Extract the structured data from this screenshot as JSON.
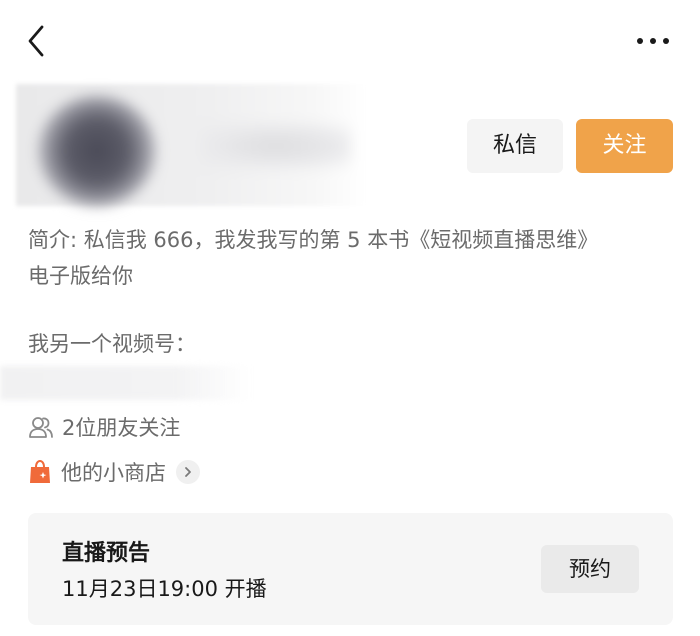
{
  "header": {
    "back_icon": "chevron-left-icon",
    "more_icon": "more-horizontal-icon"
  },
  "profile": {
    "message_button": "私信",
    "follow_button": "关注",
    "follow_color": "#f0a34a"
  },
  "bio": {
    "intro_line1": "简介: 私信我 666，我发我写的第 5 本书《短视频直播思维》",
    "intro_line2": "电子版给你",
    "other_account_label": "我另一个视频号："
  },
  "friends": {
    "icon": "users-icon",
    "text": "2位朋友关注"
  },
  "shop": {
    "icon": "shopping-bag-icon",
    "text": "他的小商店",
    "icon_color": "#f06a3a"
  },
  "live_preview": {
    "title": "直播预告",
    "time": "11月23日19:00 开播",
    "reserve_button": "预约"
  }
}
